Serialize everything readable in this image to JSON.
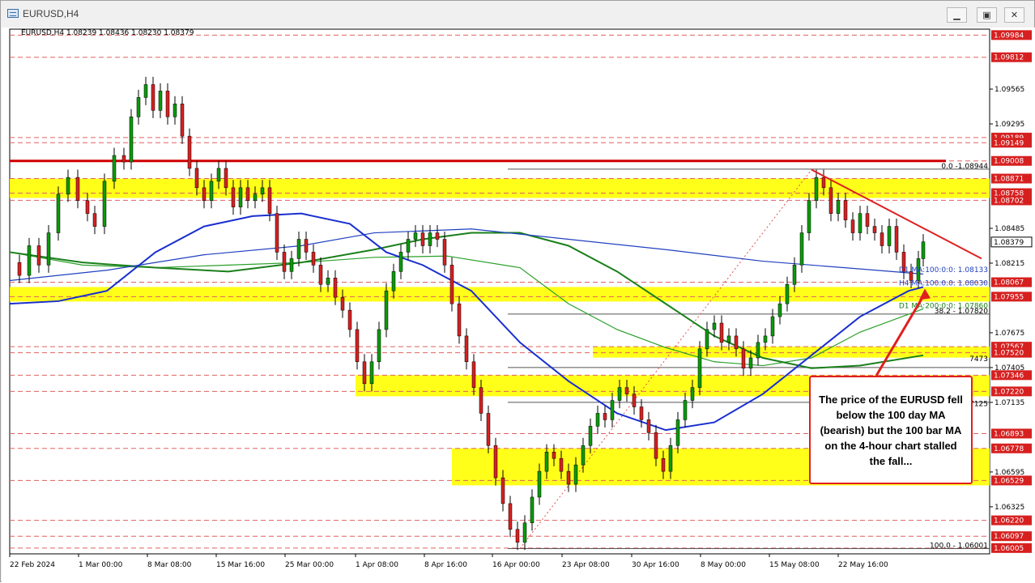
{
  "window": {
    "title": "EURUSD,H4",
    "buttons": {
      "minimize": "▁",
      "maximize": "▣",
      "close": "✕"
    }
  },
  "chart_data": {
    "type": "candlestick",
    "symbol_info": "EURUSD,H4  1.08239 1.08436 1.08230 1.08379",
    "current_price": "1.08379",
    "ylim": [
      1.0596,
      1.1003
    ],
    "price_ticks": [
      "1.09984",
      "1.09812",
      "1.09565",
      "1.09295",
      "1.09189",
      "1.09149",
      "1.09008",
      "1.08871",
      "1.08758",
      "1.08702",
      "1.08485",
      "1.08379",
      "1.08215",
      "1.08067",
      "1.07955",
      "1.07675",
      "1.07567",
      "1.07520",
      "1.07405",
      "1.07346",
      "1.07220",
      "1.07135",
      "1.06893",
      "1.06778",
      "1.06595",
      "1.06529",
      "1.06325",
      "1.06220",
      "1.06097",
      "1.06005"
    ],
    "x_ticks": [
      "22 Feb 2024",
      "1 Mar 00:00",
      "8 Mar 08:00",
      "15 Mar 16:00",
      "25 Mar 00:00",
      "1 Apr 08:00",
      "8 Apr 16:00",
      "16 Apr 00:00",
      "23 Apr 08:00",
      "30 Apr 16:00",
      "8 May 00:00",
      "15 May 08:00",
      "22 May 16:00"
    ],
    "ma_labels": {
      "d1_ma100": "D1 MA:100:0:0: 1.08133",
      "h4_ma100": "H4 MA:100:0:0: 1.08030",
      "d1_ma200": "D1 MA:200:0:0: 1.07860"
    },
    "fib_labels": {
      "fib_0": "0.0 -1.08944",
      "fib_382": "38.2 - 1.07820",
      "fib_100": "100.0 - 1.06001"
    },
    "partial_labels": {
      "left_7473": "7473",
      "left_7125": "7125"
    },
    "horizontal_levels": [
      1.09984,
      1.09812,
      1.09189,
      1.09149,
      1.09008,
      1.08871,
      1.08758,
      1.08702,
      1.08067,
      1.07955,
      1.07567,
      1.0752,
      1.07346,
      1.0722,
      1.06893,
      1.06778,
      1.06529,
      1.0622,
      1.06097,
      1.06005
    ],
    "key_level": 1.09008,
    "support_zones": [
      {
        "from": 1.08758,
        "to": 1.08871
      },
      {
        "from": 1.07955,
        "to": 1.0803
      },
      {
        "from": 1.0752,
        "to": 1.07567
      },
      {
        "from": 1.0722,
        "to": 1.07346
      },
      {
        "from": 1.06529,
        "to": 1.06778
      }
    ],
    "price_path": [
      [
        0,
        1.0822
      ],
      [
        8,
        1.0812
      ],
      [
        16,
        1.0835
      ],
      [
        24,
        1.082
      ],
      [
        32,
        1.0845
      ],
      [
        40,
        1.0875
      ],
      [
        48,
        1.0888
      ],
      [
        56,
        1.087
      ],
      [
        64,
        1.086
      ],
      [
        70,
        1.085
      ],
      [
        78,
        1.0885
      ],
      [
        86,
        1.0905
      ],
      [
        94,
        1.09
      ],
      [
        100,
        1.0935
      ],
      [
        106,
        1.095
      ],
      [
        112,
        1.096
      ],
      [
        118,
        1.094
      ],
      [
        124,
        1.0955
      ],
      [
        130,
        1.0935
      ],
      [
        136,
        1.0945
      ],
      [
        142,
        1.092
      ],
      [
        148,
        1.0895
      ],
      [
        154,
        1.088
      ],
      [
        160,
        1.087
      ],
      [
        166,
        1.0885
      ],
      [
        172,
        1.0895
      ],
      [
        178,
        1.088
      ],
      [
        184,
        1.0865
      ],
      [
        190,
        1.088
      ],
      [
        196,
        1.087
      ],
      [
        202,
        1.0875
      ],
      [
        208,
        1.088
      ],
      [
        214,
        1.086
      ],
      [
        220,
        1.083
      ],
      [
        226,
        1.0815
      ],
      [
        232,
        1.0825
      ],
      [
        238,
        1.084
      ],
      [
        244,
        1.083
      ],
      [
        250,
        1.082
      ],
      [
        256,
        1.0805
      ],
      [
        262,
        1.081
      ],
      [
        268,
        1.0795
      ],
      [
        274,
        1.0785
      ],
      [
        280,
        1.077
      ],
      [
        286,
        1.0745
      ],
      [
        292,
        1.0728
      ],
      [
        298,
        1.0745
      ],
      [
        304,
        1.077
      ],
      [
        310,
        1.08
      ],
      [
        316,
        1.0815
      ],
      [
        322,
        1.083
      ],
      [
        328,
        1.084
      ],
      [
        334,
        1.0845
      ],
      [
        340,
        1.0835
      ],
      [
        346,
        1.0845
      ],
      [
        352,
        1.084
      ],
      [
        358,
        1.082
      ],
      [
        364,
        1.079
      ],
      [
        370,
        1.0765
      ],
      [
        376,
        1.0745
      ],
      [
        382,
        1.0725
      ],
      [
        388,
        1.0705
      ],
      [
        394,
        1.068
      ],
      [
        400,
        1.0655
      ],
      [
        406,
        1.0635
      ],
      [
        412,
        1.0615
      ],
      [
        418,
        1.0605
      ],
      [
        424,
        1.062
      ],
      [
        430,
        1.064
      ],
      [
        436,
        1.066
      ],
      [
        442,
        1.0675
      ],
      [
        448,
        1.067
      ],
      [
        454,
        1.066
      ],
      [
        460,
        1.065
      ],
      [
        466,
        1.0665
      ],
      [
        472,
        1.068
      ],
      [
        478,
        1.0695
      ],
      [
        484,
        1.0705
      ],
      [
        490,
        1.07
      ],
      [
        496,
        1.0715
      ],
      [
        502,
        1.0725
      ],
      [
        508,
        1.072
      ],
      [
        514,
        1.071
      ],
      [
        520,
        1.07
      ],
      [
        526,
        1.069
      ],
      [
        532,
        1.067
      ],
      [
        538,
        1.066
      ],
      [
        544,
        1.068
      ],
      [
        550,
        1.07
      ],
      [
        556,
        1.0715
      ],
      [
        562,
        1.0725
      ],
      [
        568,
        1.0755
      ],
      [
        574,
        1.077
      ],
      [
        580,
        1.0775
      ],
      [
        586,
        1.076
      ],
      [
        592,
        1.0765
      ],
      [
        598,
        1.0755
      ],
      [
        604,
        1.074
      ],
      [
        610,
        1.0748
      ],
      [
        616,
        1.076
      ],
      [
        622,
        1.0765
      ],
      [
        628,
        1.078
      ],
      [
        634,
        1.079
      ],
      [
        640,
        1.0805
      ],
      [
        646,
        1.082
      ],
      [
        652,
        1.0845
      ],
      [
        658,
        1.087
      ],
      [
        664,
        1.0888
      ],
      [
        670,
        1.088
      ],
      [
        676,
        1.086
      ],
      [
        682,
        1.087
      ],
      [
        688,
        1.0855
      ],
      [
        694,
        1.0845
      ],
      [
        700,
        1.086
      ],
      [
        706,
        1.085
      ],
      [
        712,
        1.0845
      ],
      [
        718,
        1.0835
      ],
      [
        724,
        1.085
      ],
      [
        730,
        1.083
      ],
      [
        736,
        1.0815
      ],
      [
        742,
        1.0808
      ],
      [
        748,
        1.0825
      ],
      [
        752,
        1.0838
      ]
    ],
    "ma_d1_100": [
      [
        0,
        1.0808
      ],
      [
        80,
        1.0816
      ],
      [
        160,
        1.0828
      ],
      [
        240,
        1.0835
      ],
      [
        300,
        1.0845
      ],
      [
        380,
        1.0848
      ],
      [
        460,
        1.084
      ],
      [
        540,
        1.0832
      ],
      [
        620,
        1.0823
      ],
      [
        700,
        1.0817
      ],
      [
        752,
        1.0813
      ]
    ],
    "ma_h4_100": [
      [
        0,
        1.079
      ],
      [
        40,
        1.0792
      ],
      [
        80,
        1.08
      ],
      [
        120,
        1.083
      ],
      [
        160,
        1.085
      ],
      [
        200,
        1.0858
      ],
      [
        240,
        1.086
      ],
      [
        280,
        1.0852
      ],
      [
        310,
        1.083
      ],
      [
        340,
        1.082
      ],
      [
        380,
        1.08
      ],
      [
        420,
        1.076
      ],
      [
        460,
        1.073
      ],
      [
        500,
        1.0705
      ],
      [
        540,
        1.0692
      ],
      [
        580,
        1.0698
      ],
      [
        620,
        1.072
      ],
      [
        660,
        1.075
      ],
      [
        700,
        1.078
      ],
      [
        740,
        1.08
      ],
      [
        752,
        1.0803
      ]
    ],
    "ma_d1_200": [
      [
        0,
        1.083
      ],
      [
        60,
        1.082
      ],
      [
        120,
        1.0818
      ],
      [
        180,
        1.082
      ],
      [
        240,
        1.0822
      ],
      [
        300,
        1.0826
      ],
      [
        360,
        1.0827
      ],
      [
        420,
        1.0818
      ],
      [
        460,
        1.079
      ],
      [
        500,
        1.077
      ],
      [
        540,
        1.0756
      ],
      [
        580,
        1.0745
      ],
      [
        620,
        1.0742
      ],
      [
        660,
        1.0748
      ],
      [
        700,
        1.0768
      ],
      [
        752,
        1.0786
      ]
    ],
    "ma_h4_200": [
      [
        0,
        1.083
      ],
      [
        60,
        1.0822
      ],
      [
        120,
        1.0818
      ],
      [
        180,
        1.0815
      ],
      [
        240,
        1.0822
      ],
      [
        300,
        1.0832
      ],
      [
        340,
        1.084
      ],
      [
        380,
        1.0845
      ],
      [
        420,
        1.0845
      ],
      [
        460,
        1.0835
      ],
      [
        500,
        1.0815
      ],
      [
        540,
        1.079
      ],
      [
        580,
        1.0765
      ],
      [
        620,
        1.0748
      ],
      [
        660,
        1.074
      ],
      [
        700,
        1.0742
      ],
      [
        752,
        1.075
      ]
    ],
    "trendline": {
      "from": [
        660,
        1.0894
      ],
      "to": [
        800,
        1.0825
      ]
    },
    "retracement_dotted": {
      "from": [
        420,
        1.06
      ],
      "to": [
        660,
        1.0894
      ]
    },
    "annotation": "The price of the EURUSD fell below the 100 day MA (bearish) but the 100 bar MA on the 4-hour chart stalled the fall..."
  }
}
